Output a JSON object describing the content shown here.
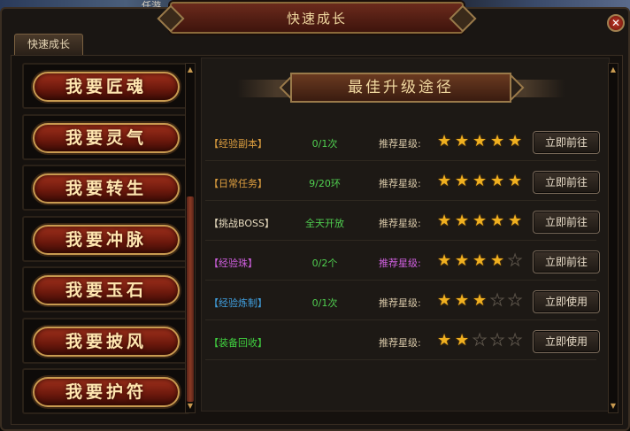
{
  "window": {
    "title": "快速成长",
    "tab": "快速成长",
    "close": "✕",
    "background_fragment": "任游"
  },
  "left_menu": [
    {
      "label": "我要匠魂"
    },
    {
      "label": "我要灵气"
    },
    {
      "label": "我要转生"
    },
    {
      "label": "我要冲脉"
    },
    {
      "label": "我要玉石"
    },
    {
      "label": "我要披风"
    },
    {
      "label": "我要护符"
    }
  ],
  "panel": {
    "heading": "最佳升级途径",
    "rows": [
      {
        "name": "【经验副本】",
        "name_color": "#e0a040",
        "count": "0/1次",
        "rating_label": "推荐星级:",
        "label_color": "#d8c8a8",
        "stars": 5,
        "button": "立即前往"
      },
      {
        "name": "【日常任务】",
        "name_color": "#e0a040",
        "count": "9/20环",
        "rating_label": "推荐星级:",
        "label_color": "#d8c8a8",
        "stars": 5,
        "button": "立即前往"
      },
      {
        "name": "【挑战BOSS】",
        "name_color": "#e8dcc0",
        "count": "全天开放",
        "rating_label": "推荐星级:",
        "label_color": "#d8c8a8",
        "stars": 5,
        "button": "立即前往"
      },
      {
        "name": "【经验珠】",
        "name_color": "#d060e0",
        "count": "0/2个",
        "rating_label": "推荐星级:",
        "label_color": "#d060e0",
        "stars": 4,
        "button": "立即前往"
      },
      {
        "name": "【经验炼制】",
        "name_color": "#40a0e0",
        "count": "0/1次",
        "rating_label": "推荐星级:",
        "label_color": "#d8c8a8",
        "stars": 3,
        "button": "立即使用"
      },
      {
        "name": "【装备回收】",
        "name_color": "#40d040",
        "count": "",
        "rating_label": "推荐星级:",
        "label_color": "#d8c8a8",
        "stars": 2,
        "button": "立即使用"
      }
    ]
  },
  "star_icon": "star-icon",
  "colors": {
    "accent": "#c89a50",
    "button_red": "#a0301c",
    "count_green": "#50d050",
    "star": "#f0b020"
  }
}
